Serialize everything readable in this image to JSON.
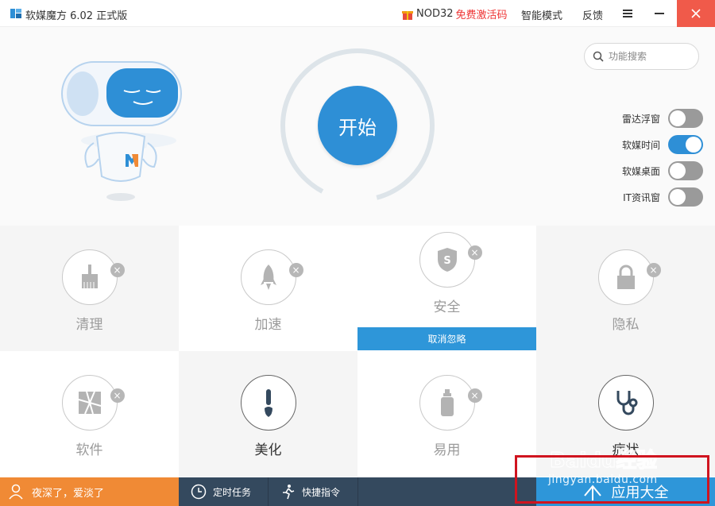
{
  "titlebar": {
    "app_title": "软媒魔方 6.02 正式版",
    "promo_nod": "NOD32",
    "promo_free": "免费激活码",
    "smart_mode": "智能模式",
    "feedback": "反馈",
    "menu_icon": "menu-icon",
    "minimize_icon": "minimize-icon",
    "close_icon": "close-icon"
  },
  "search": {
    "placeholder": "功能搜索"
  },
  "start": {
    "label": "开始"
  },
  "toggles": [
    {
      "label": "雷达浮窗",
      "on": false
    },
    {
      "label": "软媒时间",
      "on": true
    },
    {
      "label": "软媒桌面",
      "on": false
    },
    {
      "label": "IT资讯窗",
      "on": false
    }
  ],
  "tiles": [
    {
      "label": "清理",
      "icon": "broom-icon"
    },
    {
      "label": "加速",
      "icon": "rocket-icon"
    },
    {
      "label": "安全",
      "icon": "shield-icon"
    },
    {
      "label": "隐私",
      "icon": "lock-icon"
    },
    {
      "label": "软件",
      "icon": "aperture-icon"
    },
    {
      "label": "美化",
      "icon": "brush-icon"
    },
    {
      "label": "易用",
      "icon": "bottle-icon"
    },
    {
      "label": "症状",
      "icon": "stethoscope-icon"
    }
  ],
  "cancel_ignore": "取消忽略",
  "bottom": {
    "greeting": "夜深了，爱淡了",
    "scheduled_tasks": "定时任务",
    "quick_commands": "快捷指令",
    "app_center": "应用大全"
  },
  "watermark": {
    "brand": "Baidu经验",
    "url": "jingyan.baidu.com"
  },
  "colors": {
    "accent": "#2e8fd6",
    "orange": "#f08a35",
    "dark": "#34495e",
    "close": "#f05a4a",
    "highlight": "#d0141f"
  }
}
